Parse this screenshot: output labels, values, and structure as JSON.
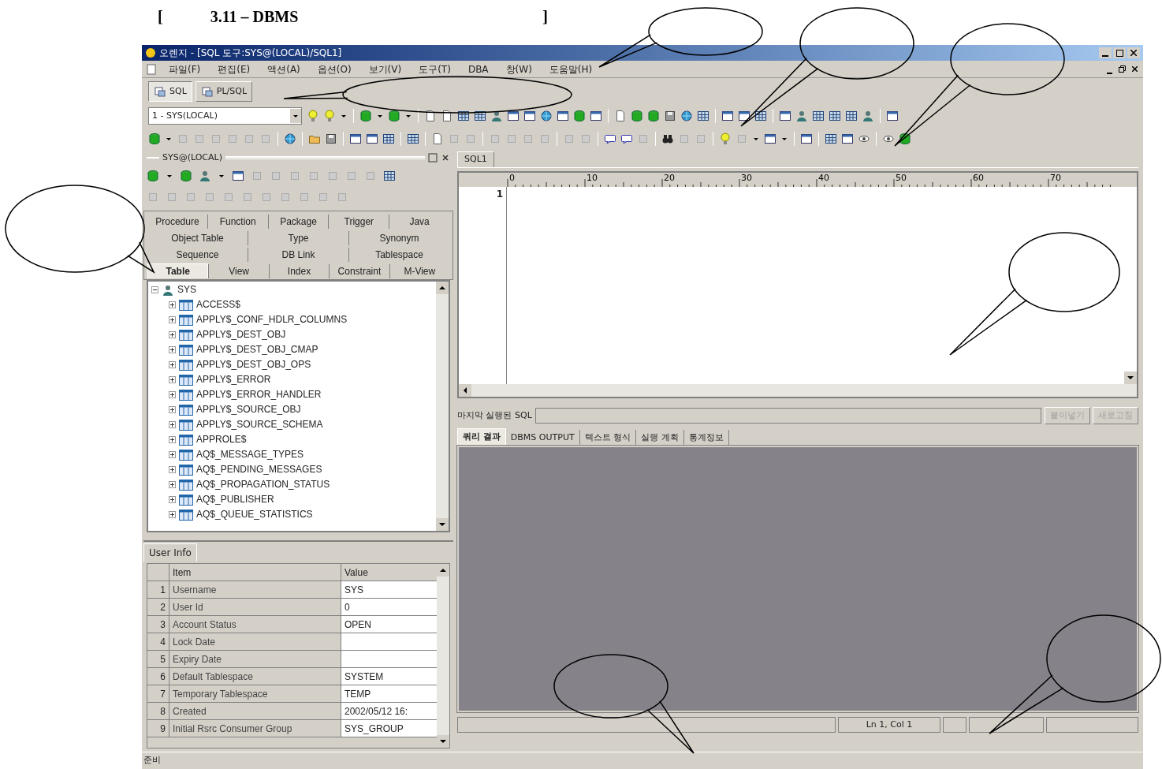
{
  "caption": {
    "open": "[",
    "text": "3.11 – DBMS",
    "close": "]"
  },
  "window": {
    "title": "오렌지 - [SQL 도구:SYS@(LOCAL)/SQL1]"
  },
  "menu": [
    "파일(F)",
    "편집(E)",
    "액션(A)",
    "옵션(O)",
    "보기(V)",
    "도구(T)",
    "DBA",
    "창(W)",
    "도움말(H)"
  ],
  "mode_buttons": [
    {
      "label": "SQL",
      "selected": true
    },
    {
      "label": "PL/SQL",
      "selected": false
    }
  ],
  "connection": {
    "value": "1 - SYS(LOCAL)"
  },
  "object_panel": {
    "title": "SYS@(LOCAL)",
    "tab_rows": [
      [
        {
          "label": "Procedure",
          "selected": false
        },
        {
          "label": "Function",
          "selected": false
        },
        {
          "label": "Package",
          "selected": false
        },
        {
          "label": "Trigger",
          "selected": false
        },
        {
          "label": "Java",
          "selected": false
        }
      ],
      [
        {
          "label": "Object Table",
          "selected": false
        },
        {
          "label": "Type",
          "selected": false
        },
        {
          "label": "Synonym",
          "selected": false
        }
      ],
      [
        {
          "label": "Sequence",
          "selected": false
        },
        {
          "label": "DB Link",
          "selected": false
        },
        {
          "label": "Tablespace",
          "selected": false
        }
      ],
      [
        {
          "label": "Table",
          "selected": true
        },
        {
          "label": "View",
          "selected": false
        },
        {
          "label": "Index",
          "selected": false
        },
        {
          "label": "Constraint",
          "selected": false
        },
        {
          "label": "M-View",
          "selected": false
        }
      ]
    ],
    "tree": [
      {
        "label": "SYS",
        "expanded": true,
        "children": [
          {
            "label": "ACCESS$",
            "expanded": false
          },
          {
            "label": "APPLY$_CONF_HDLR_COLUMNS",
            "expanded": false
          },
          {
            "label": "APPLY$_DEST_OBJ",
            "expanded": false
          },
          {
            "label": "APPLY$_DEST_OBJ_CMAP",
            "expanded": false
          },
          {
            "label": "APPLY$_DEST_OBJ_OPS",
            "expanded": false
          },
          {
            "label": "APPLY$_ERROR",
            "expanded": false
          },
          {
            "label": "APPLY$_ERROR_HANDLER",
            "expanded": false
          },
          {
            "label": "APPLY$_SOURCE_OBJ",
            "expanded": false
          },
          {
            "label": "APPLY$_SOURCE_SCHEMA",
            "expanded": false
          },
          {
            "label": "APPROLE$",
            "expanded": false
          },
          {
            "label": "AQ$_MESSAGE_TYPES",
            "expanded": false
          },
          {
            "label": "AQ$_PENDING_MESSAGES",
            "expanded": false
          },
          {
            "label": "AQ$_PROPAGATION_STATUS",
            "expanded": false
          },
          {
            "label": "AQ$_PUBLISHER",
            "expanded": false
          },
          {
            "label": "AQ$_QUEUE_STATISTICS",
            "expanded": false
          }
        ]
      }
    ]
  },
  "user_info": {
    "tab": "User Info",
    "columns": [
      "",
      "Item",
      "Value"
    ],
    "rows": [
      [
        "1",
        "Username",
        "SYS"
      ],
      [
        "2",
        "User Id",
        "0"
      ],
      [
        "3",
        "Account Status",
        "OPEN"
      ],
      [
        "4",
        "Lock Date",
        ""
      ],
      [
        "5",
        "Expiry Date",
        ""
      ],
      [
        "6",
        "Default Tablespace",
        "SYSTEM"
      ],
      [
        "7",
        "Temporary Tablespace",
        "TEMP"
      ],
      [
        "8",
        "Created",
        "2002/05/12 16:"
      ],
      [
        "9",
        "Initial Rsrc Consumer Group",
        "SYS_GROUP"
      ]
    ]
  },
  "editor": {
    "tab": "SQL1",
    "ruler": [
      "0",
      "10",
      "20",
      "30",
      "40",
      "50",
      "60",
      "70"
    ],
    "line_numbers": [
      "1"
    ]
  },
  "last_sql": {
    "label": "마지막 실행된 SQL",
    "buttons": [
      {
        "label": "붙이넣기",
        "disabled": true
      },
      {
        "label": "새로고침",
        "disabled": true
      }
    ]
  },
  "result_tabs": [
    {
      "label": "쿼리 결과",
      "selected": true
    },
    {
      "label": "DBMS OUTPUT",
      "selected": false
    },
    {
      "label": "텍스트 형식",
      "selected": false
    },
    {
      "label": "실행 계획",
      "selected": false
    },
    {
      "label": "통계정보",
      "selected": false
    }
  ],
  "status_bar": {
    "position": "Ln 1, Col 1",
    "message": "준비"
  }
}
